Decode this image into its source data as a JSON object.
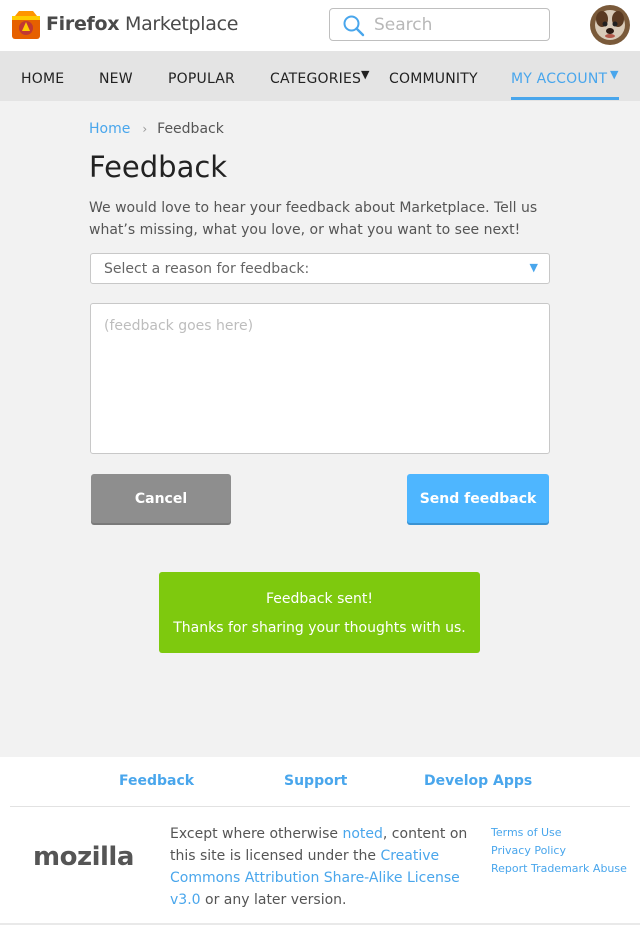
{
  "header": {
    "brand_light": "Firefox",
    "brand_rest": " Marketplace",
    "search_placeholder": "Search"
  },
  "nav": {
    "items": [
      {
        "label": "HOME"
      },
      {
        "label": "NEW"
      },
      {
        "label": "POPULAR"
      },
      {
        "label": "CATEGORIES",
        "caret": "▼"
      },
      {
        "label": "COMMUNITY"
      },
      {
        "label": "MY ACCOUNT",
        "caret": "▼",
        "active": true
      }
    ]
  },
  "breadcrumb": {
    "home": "Home",
    "separator": "›",
    "current": "Feedback"
  },
  "page": {
    "title": "Feedback",
    "intro": "We would love to hear your feedback about Marketplace. Tell us what’s missing, what you love, or what you want to see next!",
    "select_label": "Select a reason for feedback:",
    "select_arrow": "▼",
    "textarea_placeholder": "(feedback goes here)",
    "cancel_label": "Cancel",
    "send_label": "Send feedback"
  },
  "toast": {
    "line1": "Feedback sent!",
    "line2": "Thanks for sharing your thoughts with us."
  },
  "footer": {
    "links": [
      "Feedback",
      "Support",
      "Develop Apps"
    ],
    "logo_text": "mozilla",
    "license_pre": "Except where otherwise ",
    "license_link1": "noted",
    "license_mid": ", content on this site is licensed under the ",
    "license_link2": "Creative Commons Attribution Share-Alike License v3.0",
    "license_post": " or any later version.",
    "legal": [
      "Terms of Use",
      "Privacy Policy",
      "Report Trademark Abuse"
    ]
  },
  "colors": {
    "accent": "#49a6ec",
    "send_button": "#4eb6ff",
    "toast": "#7ec90e",
    "cancel_button": "#8e8e8e"
  }
}
